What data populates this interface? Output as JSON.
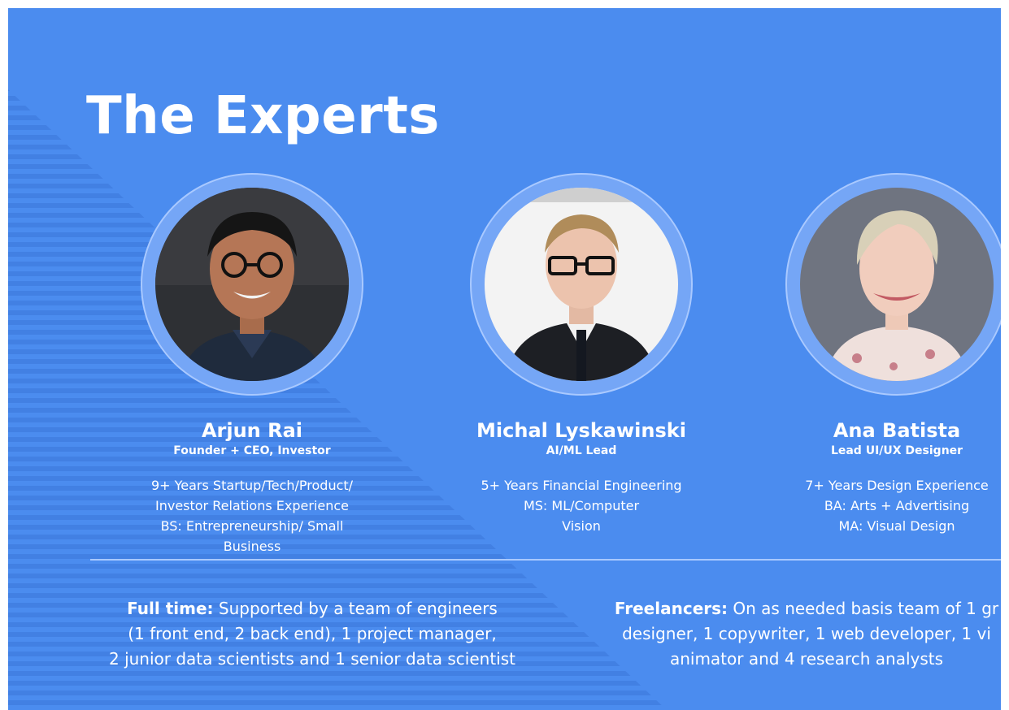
{
  "slide": {
    "title": "The Experts",
    "experts": [
      {
        "name": "Arjun Rai",
        "role": "Founder + CEO, Investor",
        "bio": [
          "9+ Years Startup/Tech/Product/",
          "Investor Relations Experience",
          "BS: Entrepreneurship/ Small",
          "Business"
        ]
      },
      {
        "name": "Michal Lyskawinski",
        "role": "AI/ML Lead",
        "bio": [
          "5+ Years Financial Engineering",
          "MS: ML/Computer",
          "Vision"
        ]
      },
      {
        "name": "Ana Batista",
        "role": "Lead UI/UX Designer",
        "bio": [
          "7+ Years Design Experience",
          "BA: Arts + Advertising",
          "MA: Visual Design"
        ]
      }
    ],
    "fulltime": {
      "label": "Full time:",
      "lines": [
        " Supported by a team of engineers",
        "(1 front end, 2 back end), 1 project manager,",
        "2 junior data scientists and 1 senior data scientist"
      ]
    },
    "freelancers": {
      "label": "Freelancers:",
      "lines": [
        " On as needed basis team of 1 gr",
        "designer, 1 copywriter, 1 web developer, 1 vi",
        "animator and 4 research analysts"
      ]
    }
  },
  "colors": {
    "background": "#4b8cef",
    "ring": "#75a6f6",
    "text": "#ffffff"
  }
}
